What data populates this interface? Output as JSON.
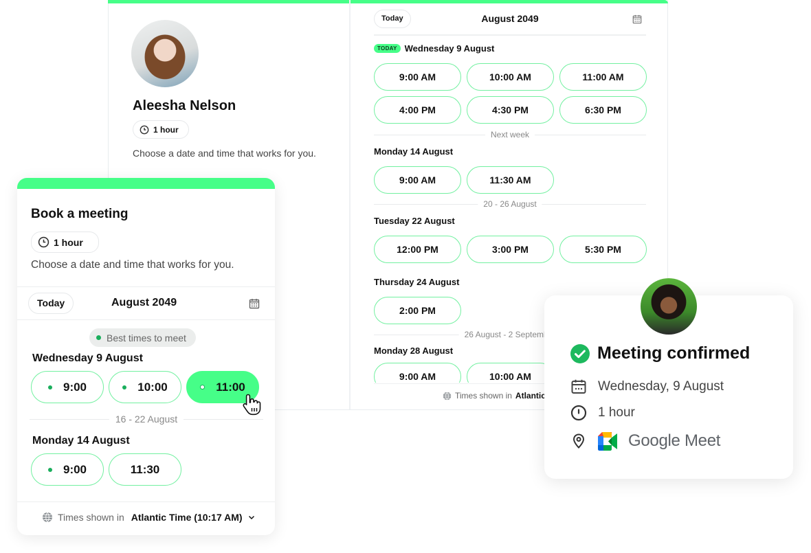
{
  "colors": {
    "accent": "#46fe88",
    "slot_border": "#72f0a0",
    "best_dot": "#1aae5c",
    "confirm_check": "#1db95e"
  },
  "host_panel": {
    "host_name": "Aleesha Nelson",
    "duration": "1 hour",
    "description": "Choose a date and time that works for you.",
    "avatar_icon": "host-avatar"
  },
  "schedule_panel": {
    "today_button": "Today",
    "month": "August 2049",
    "calendar_icon": "calendar-icon",
    "today_badge": "TODAY",
    "days": [
      {
        "label": "Wednesday 9 August",
        "slots": [
          "9:00 AM",
          "10:00 AM",
          "11:00 AM",
          "4:00 PM",
          "4:30 PM",
          "6:30 PM"
        ]
      },
      {
        "label": "Monday 14 August",
        "slots": [
          "9:00 AM",
          "11:30 AM"
        ]
      },
      {
        "label": "Tuesday 22 August",
        "slots": [
          "12:00 PM",
          "3:00 PM",
          "5:30 PM"
        ]
      },
      {
        "label": "Thursday 24 August",
        "slots": [
          "2:00 PM"
        ]
      },
      {
        "label": "Monday 28 August",
        "slots": [
          "9:00 AM",
          "10:00 AM"
        ]
      }
    ],
    "separators": [
      "Next week",
      "20 - 26 August",
      "26 August - 2 September"
    ],
    "footer": {
      "prefix": "Times shown in",
      "timezone": "Atlantic Time"
    }
  },
  "booking_card": {
    "title": "Book a meeting",
    "duration": "1 hour",
    "description": "Choose a date and time that works for you.",
    "today_button": "Today",
    "month": "August 2049",
    "best_times_label": "Best times to meet",
    "days": [
      {
        "label": "Wednesday 9 August",
        "slots": [
          {
            "time": "9:00",
            "best": true,
            "selected": false
          },
          {
            "time": "10:00",
            "best": true,
            "selected": false
          },
          {
            "time": "11:00",
            "best": true,
            "selected": true
          }
        ]
      },
      {
        "label": "Monday 14 August",
        "slots": [
          {
            "time": "9:00",
            "best": true,
            "selected": false
          },
          {
            "time": "11:30",
            "best": false,
            "selected": false
          }
        ]
      }
    ],
    "separator": "16 - 22 August",
    "footer": {
      "prefix": "Times shown in",
      "timezone": "Atlantic Time (10:17 AM)"
    }
  },
  "confirmation": {
    "title": "Meeting confirmed",
    "date": "Wednesday, 9 August",
    "duration": "1 hour",
    "location": "Google Meet"
  }
}
